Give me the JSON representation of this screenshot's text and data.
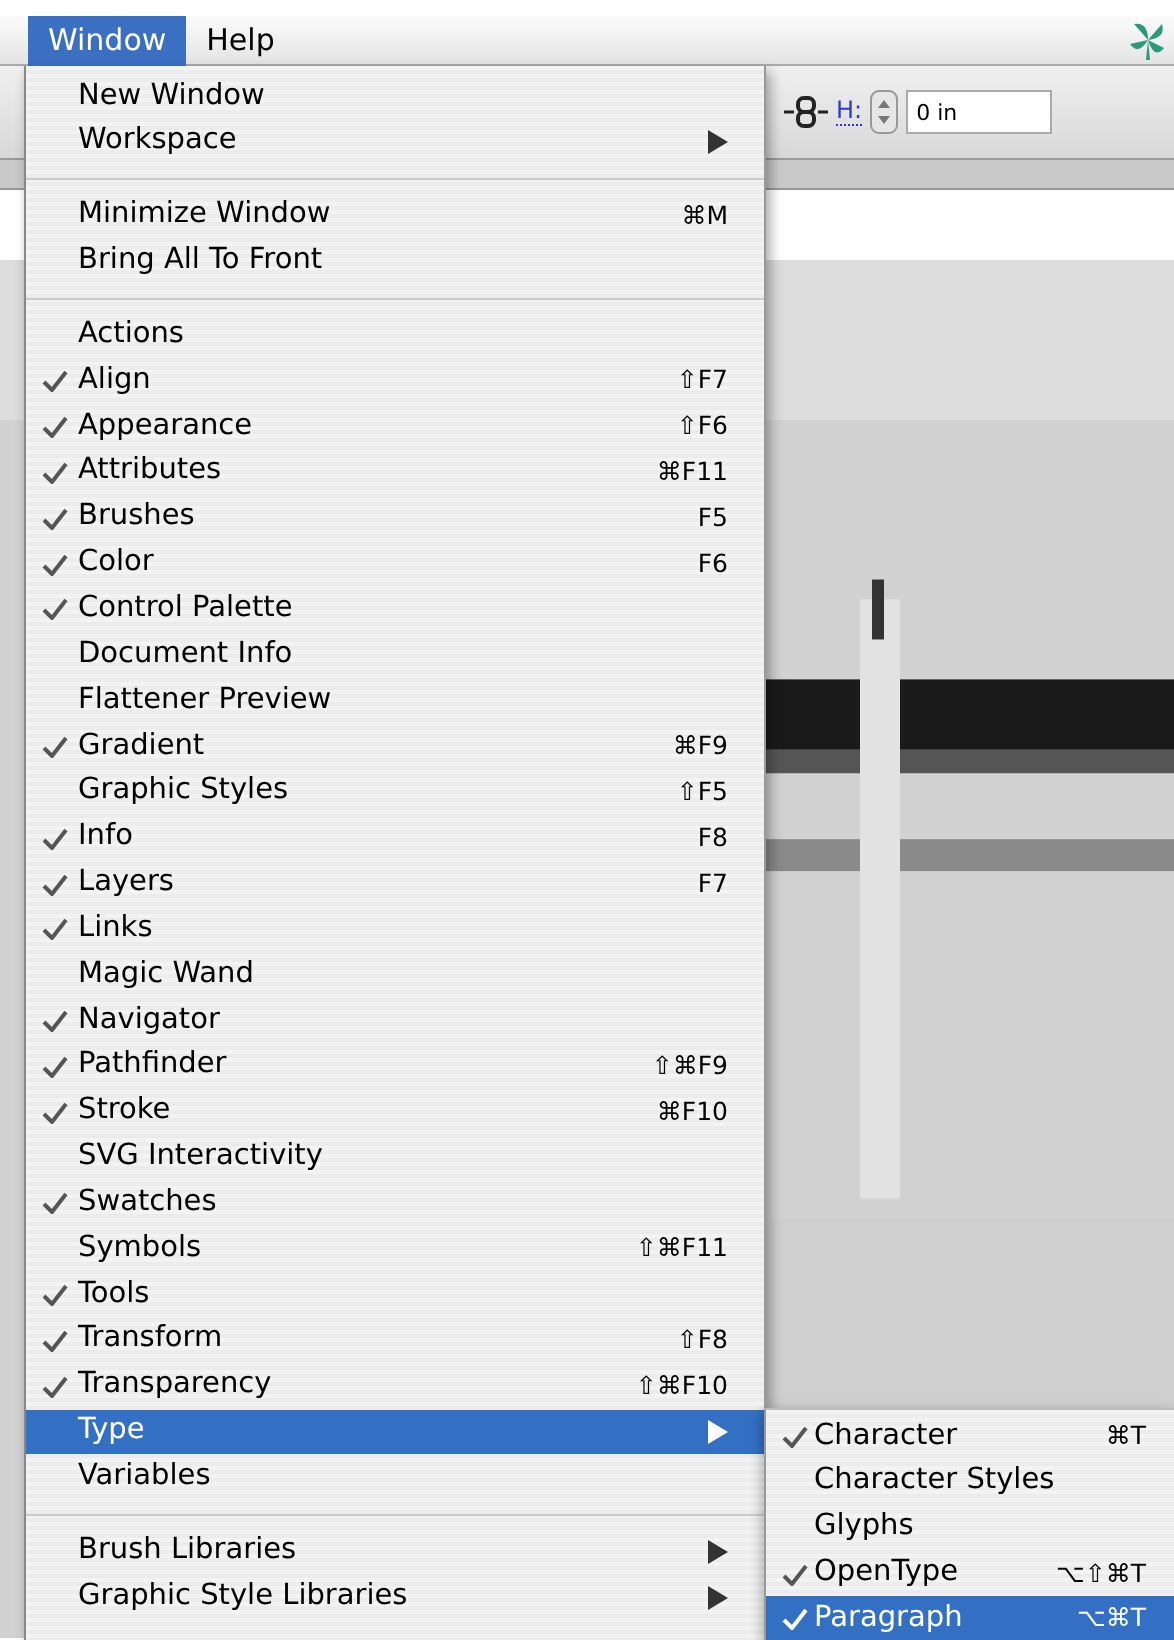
{
  "menu_bar": {
    "menus": [
      {
        "label": "Window",
        "selected": true
      },
      {
        "label": "Help",
        "selected": false
      }
    ]
  },
  "toolbar": {
    "h_label": "H:",
    "h_value": "0 in"
  },
  "window_menu": {
    "items": [
      {
        "kind": "item",
        "label": "New Window",
        "checked": false,
        "has_submenu": false,
        "selected": false
      },
      {
        "kind": "item",
        "label": "Workspace",
        "checked": false,
        "has_submenu": true,
        "selected": false
      },
      {
        "kind": "separator"
      },
      {
        "kind": "item",
        "label": "Minimize Window",
        "checked": false,
        "shortcut": "⌘M",
        "has_submenu": false,
        "selected": false
      },
      {
        "kind": "item",
        "label": "Bring All To Front",
        "checked": false,
        "has_submenu": false,
        "selected": false
      },
      {
        "kind": "separator"
      },
      {
        "kind": "item",
        "label": "Actions",
        "checked": false,
        "has_submenu": false,
        "selected": false
      },
      {
        "kind": "item",
        "label": "Align",
        "checked": true,
        "shortcut": "⇧F7",
        "has_submenu": false,
        "selected": false
      },
      {
        "kind": "item",
        "label": "Appearance",
        "checked": true,
        "shortcut": "⇧F6",
        "has_submenu": false,
        "selected": false
      },
      {
        "kind": "item",
        "label": "Attributes",
        "checked": true,
        "shortcut": "⌘F11",
        "has_submenu": false,
        "selected": false
      },
      {
        "kind": "item",
        "label": "Brushes",
        "checked": true,
        "shortcut": "F5",
        "has_submenu": false,
        "selected": false
      },
      {
        "kind": "item",
        "label": "Color",
        "checked": true,
        "shortcut": "F6",
        "has_submenu": false,
        "selected": false
      },
      {
        "kind": "item",
        "label": "Control Palette",
        "checked": true,
        "has_submenu": false,
        "selected": false
      },
      {
        "kind": "item",
        "label": "Document Info",
        "checked": false,
        "has_submenu": false,
        "selected": false
      },
      {
        "kind": "item",
        "label": "Flattener Preview",
        "checked": false,
        "has_submenu": false,
        "selected": false
      },
      {
        "kind": "item",
        "label": "Gradient",
        "checked": true,
        "shortcut": "⌘F9",
        "has_submenu": false,
        "selected": false
      },
      {
        "kind": "item",
        "label": "Graphic Styles",
        "checked": false,
        "shortcut": "⇧F5",
        "has_submenu": false,
        "selected": false
      },
      {
        "kind": "item",
        "label": "Info",
        "checked": true,
        "shortcut": "F8",
        "has_submenu": false,
        "selected": false
      },
      {
        "kind": "item",
        "label": "Layers",
        "checked": true,
        "shortcut": "F7",
        "has_submenu": false,
        "selected": false
      },
      {
        "kind": "item",
        "label": "Links",
        "checked": true,
        "has_submenu": false,
        "selected": false
      },
      {
        "kind": "item",
        "label": "Magic Wand",
        "checked": false,
        "has_submenu": false,
        "selected": false
      },
      {
        "kind": "item",
        "label": "Navigator",
        "checked": true,
        "has_submenu": false,
        "selected": false
      },
      {
        "kind": "item",
        "label": "Pathfinder",
        "checked": true,
        "shortcut": "⇧⌘F9",
        "has_submenu": false,
        "selected": false
      },
      {
        "kind": "item",
        "label": "Stroke",
        "checked": true,
        "shortcut": "⌘F10",
        "has_submenu": false,
        "selected": false
      },
      {
        "kind": "item",
        "label": "SVG Interactivity",
        "checked": false,
        "has_submenu": false,
        "selected": false
      },
      {
        "kind": "item",
        "label": "Swatches",
        "checked": true,
        "has_submenu": false,
        "selected": false
      },
      {
        "kind": "item",
        "label": "Symbols",
        "checked": false,
        "shortcut": "⇧⌘F11",
        "has_submenu": false,
        "selected": false
      },
      {
        "kind": "item",
        "label": "Tools",
        "checked": true,
        "has_submenu": false,
        "selected": false
      },
      {
        "kind": "item",
        "label": "Transform",
        "checked": true,
        "shortcut": "⇧F8",
        "has_submenu": false,
        "selected": false
      },
      {
        "kind": "item",
        "label": "Transparency",
        "checked": true,
        "shortcut": "⇧⌘F10",
        "has_submenu": false,
        "selected": false
      },
      {
        "kind": "item",
        "label": "Type",
        "checked": false,
        "has_submenu": true,
        "selected": true
      },
      {
        "kind": "item",
        "label": "Variables",
        "checked": false,
        "has_submenu": false,
        "selected": false
      },
      {
        "kind": "separator"
      },
      {
        "kind": "item",
        "label": "Brush Libraries",
        "checked": false,
        "has_submenu": true,
        "selected": false
      },
      {
        "kind": "item",
        "label": "Graphic Style Libraries",
        "checked": false,
        "has_submenu": true,
        "selected": false
      }
    ]
  },
  "type_submenu": {
    "items": [
      {
        "kind": "item",
        "label": "Character",
        "checked": true,
        "shortcut": "⌘T",
        "has_submenu": false,
        "selected": false
      },
      {
        "kind": "item",
        "label": "Character Styles",
        "checked": false,
        "has_submenu": false,
        "selected": false
      },
      {
        "kind": "item",
        "label": "Glyphs",
        "checked": false,
        "has_submenu": false,
        "selected": false
      },
      {
        "kind": "item",
        "label": "OpenType",
        "checked": true,
        "shortcut": "⌥⇧⌘T",
        "has_submenu": false,
        "selected": false
      },
      {
        "kind": "item",
        "label": "Paragraph",
        "checked": true,
        "shortcut": "⌥⌘T",
        "has_submenu": false,
        "selected": true
      }
    ]
  }
}
